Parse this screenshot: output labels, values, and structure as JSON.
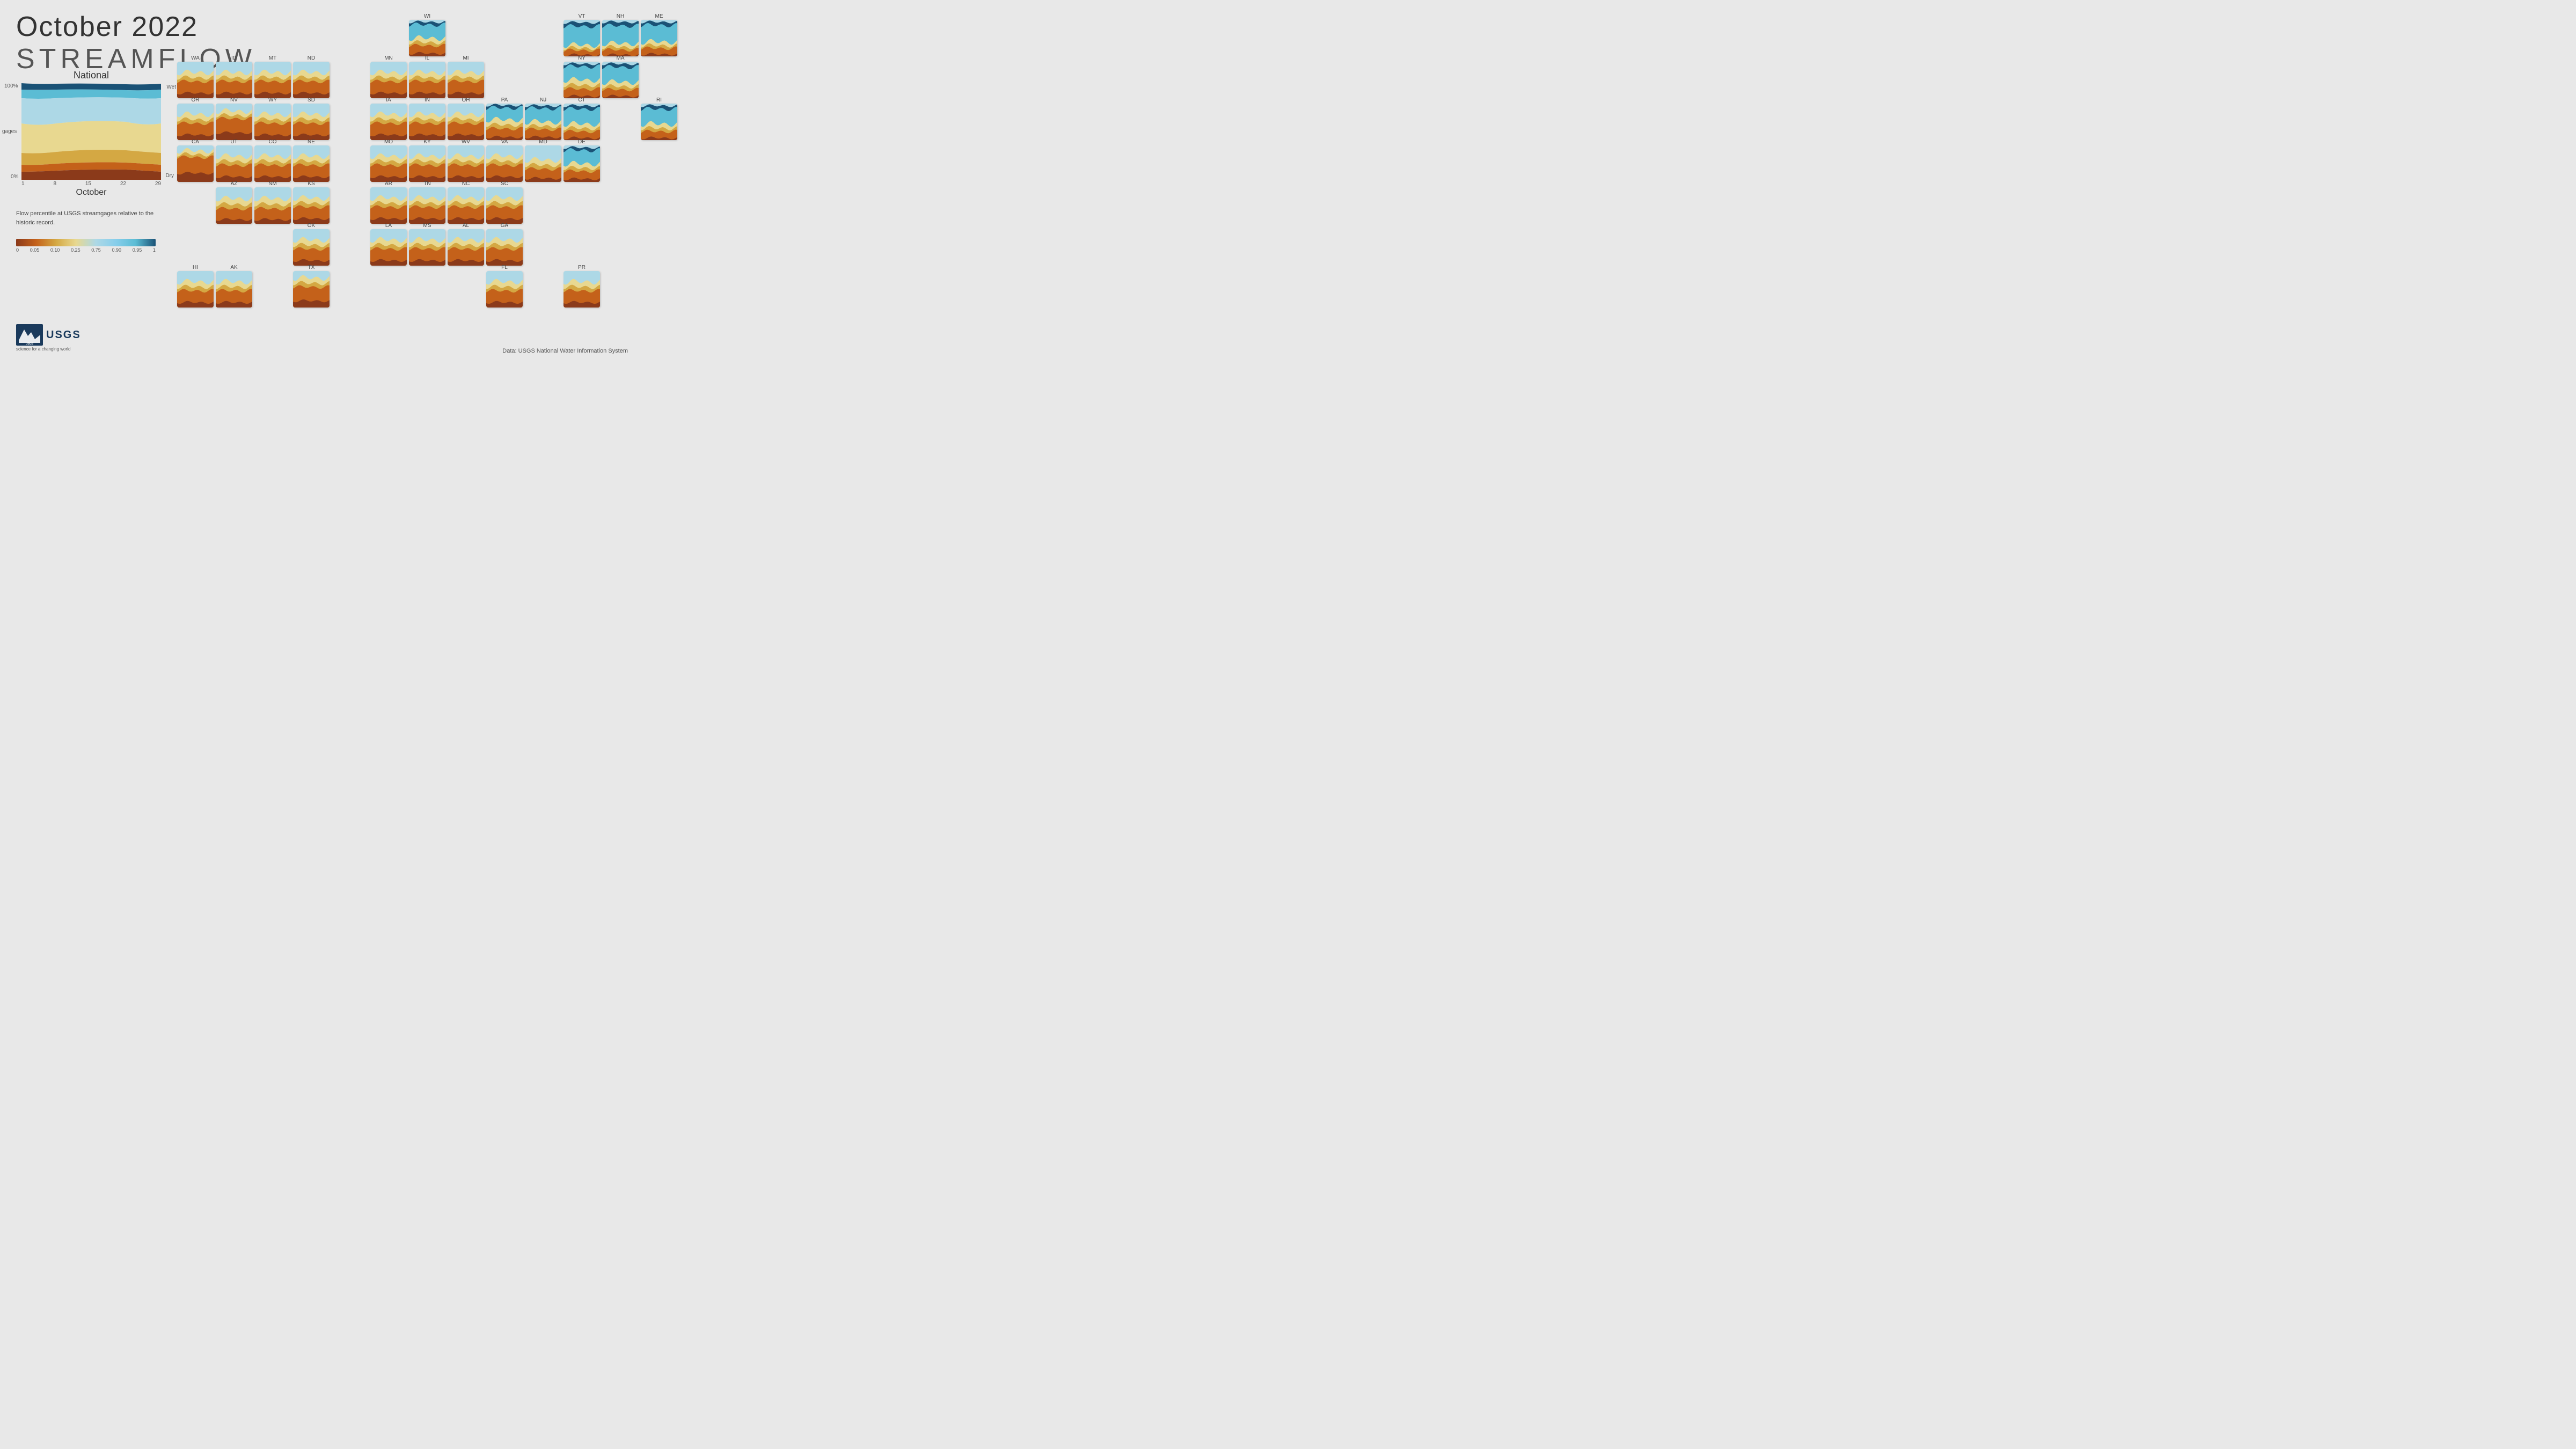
{
  "title": {
    "line1": "October 2022",
    "line2": "STREAMFLOW"
  },
  "chart": {
    "title": "National",
    "y_labels": [
      "100%",
      "gages",
      "0%"
    ],
    "x_labels": [
      "1",
      "8",
      "15",
      "22",
      "29"
    ],
    "x_axis_label": "October",
    "legend_wet": "Wet",
    "legend_dry": "Dry"
  },
  "description": {
    "text": "Flow percentile at USGS streamgages relative to the historic record."
  },
  "color_bar": {
    "labels": [
      "0",
      "0.05",
      "0.10",
      "0.25",
      "0.75",
      "0.90",
      "0.95",
      "1"
    ]
  },
  "usgs": {
    "name": "USGS",
    "tagline": "science for a changing world"
  },
  "data_source": {
    "text": "Data: USGS National Water Information System"
  },
  "states": [
    {
      "id": "WI",
      "label": "WI",
      "col": 7,
      "row": 0
    },
    {
      "id": "VT",
      "label": "VT",
      "col": 11,
      "row": 0
    },
    {
      "id": "NH",
      "label": "NH",
      "col": 12,
      "row": 0
    },
    {
      "id": "ME",
      "label": "ME",
      "col": 13,
      "row": 0
    },
    {
      "id": "WA",
      "label": "WA",
      "col": 1,
      "row": 1
    },
    {
      "id": "ID",
      "label": "ID",
      "col": 2,
      "row": 1
    },
    {
      "id": "MT",
      "label": "MT",
      "col": 3,
      "row": 1
    },
    {
      "id": "ND",
      "label": "ND",
      "col": 4,
      "row": 1
    },
    {
      "id": "MN",
      "label": "MN",
      "col": 6,
      "row": 1
    },
    {
      "id": "IL",
      "label": "IL",
      "col": 7,
      "row": 1
    },
    {
      "id": "MI",
      "label": "MI",
      "col": 8,
      "row": 1
    },
    {
      "id": "NY",
      "label": "NY",
      "col": 11,
      "row": 1
    },
    {
      "id": "MA",
      "label": "MA",
      "col": 12,
      "row": 1
    },
    {
      "id": "OR",
      "label": "OR",
      "col": 1,
      "row": 2
    },
    {
      "id": "NV",
      "label": "NV",
      "col": 2,
      "row": 2
    },
    {
      "id": "WY",
      "label": "WY",
      "col": 3,
      "row": 2
    },
    {
      "id": "SD",
      "label": "SD",
      "col": 4,
      "row": 2
    },
    {
      "id": "IA",
      "label": "IA",
      "col": 6,
      "row": 2
    },
    {
      "id": "IN",
      "label": "IN",
      "col": 7,
      "row": 2
    },
    {
      "id": "OH",
      "label": "OH",
      "col": 8,
      "row": 2
    },
    {
      "id": "PA",
      "label": "PA",
      "col": 9,
      "row": 2
    },
    {
      "id": "NJ",
      "label": "NJ",
      "col": 10,
      "row": 2
    },
    {
      "id": "CT",
      "label": "CT",
      "col": 11,
      "row": 2
    },
    {
      "id": "RI",
      "label": "RI",
      "col": 13,
      "row": 2
    },
    {
      "id": "CA",
      "label": "CA",
      "col": 1,
      "row": 3
    },
    {
      "id": "UT",
      "label": "UT",
      "col": 2,
      "row": 3
    },
    {
      "id": "CO",
      "label": "CO",
      "col": 3,
      "row": 3
    },
    {
      "id": "NE",
      "label": "NE",
      "col": 4,
      "row": 3
    },
    {
      "id": "MO",
      "label": "MO",
      "col": 6,
      "row": 3
    },
    {
      "id": "KY",
      "label": "KY",
      "col": 7,
      "row": 3
    },
    {
      "id": "WV",
      "label": "WV",
      "col": 8,
      "row": 3
    },
    {
      "id": "VA",
      "label": "VA",
      "col": 9,
      "row": 3
    },
    {
      "id": "MD",
      "label": "MD",
      "col": 10,
      "row": 3
    },
    {
      "id": "DE",
      "label": "DE",
      "col": 11,
      "row": 3
    },
    {
      "id": "AZ",
      "label": "AZ",
      "col": 2,
      "row": 4
    },
    {
      "id": "NM",
      "label": "NM",
      "col": 3,
      "row": 4
    },
    {
      "id": "KS",
      "label": "KS",
      "col": 4,
      "row": 4
    },
    {
      "id": "AR",
      "label": "AR",
      "col": 6,
      "row": 4
    },
    {
      "id": "TN",
      "label": "TN",
      "col": 7,
      "row": 4
    },
    {
      "id": "NC",
      "label": "NC",
      "col": 8,
      "row": 4
    },
    {
      "id": "SC",
      "label": "SC",
      "col": 9,
      "row": 4
    },
    {
      "id": "OK",
      "label": "OK",
      "col": 4,
      "row": 5
    },
    {
      "id": "LA",
      "label": "LA",
      "col": 6,
      "row": 5
    },
    {
      "id": "MS",
      "label": "MS",
      "col": 7,
      "row": 5
    },
    {
      "id": "AL",
      "label": "AL",
      "col": 8,
      "row": 5
    },
    {
      "id": "GA",
      "label": "GA",
      "col": 9,
      "row": 5
    },
    {
      "id": "HI",
      "label": "HI",
      "col": 1,
      "row": 6
    },
    {
      "id": "AK",
      "label": "AK",
      "col": 2,
      "row": 6
    },
    {
      "id": "TX",
      "label": "TX",
      "col": 4,
      "row": 6
    },
    {
      "id": "FL",
      "label": "FL",
      "col": 9,
      "row": 6
    },
    {
      "id": "PR",
      "label": "PR",
      "col": 11,
      "row": 6
    }
  ]
}
